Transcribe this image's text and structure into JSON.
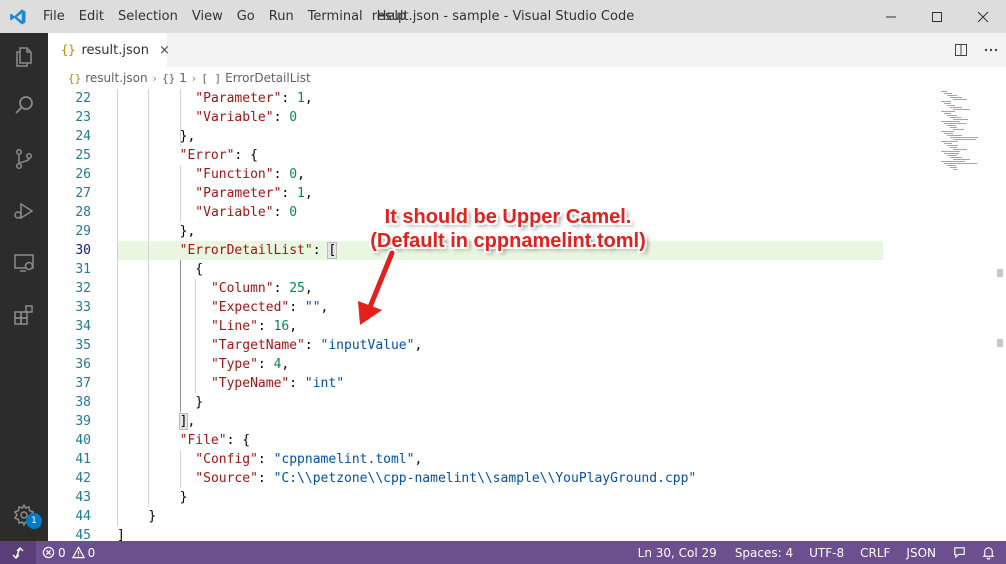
{
  "window": {
    "title": "result.json - sample - Visual Studio Code",
    "menu": [
      "File",
      "Edit",
      "Selection",
      "View",
      "Go",
      "Run",
      "Terminal",
      "Help"
    ]
  },
  "activity": {
    "icons": [
      "files-icon",
      "search-icon",
      "source-control-icon",
      "run-debug-icon",
      "remote-explorer-icon",
      "extensions-icon"
    ],
    "settings_badge": "1"
  },
  "tab": {
    "icon": "{}",
    "label": "result.json",
    "close": "×"
  },
  "breadcrumb": {
    "file": "result.json",
    "obj_icon": "{}",
    "obj": "1",
    "arr_icon": "[ ]",
    "arr": "ErrorDetailList"
  },
  "editor": {
    "current_line": 30,
    "lines": [
      {
        "n": "22",
        "indent": 5,
        "tokens": [
          [
            "k",
            "\"Parameter\""
          ],
          [
            "p",
            ": "
          ],
          [
            "n",
            "1"
          ],
          [
            "p",
            ","
          ]
        ]
      },
      {
        "n": "23",
        "indent": 5,
        "tokens": [
          [
            "k",
            "\"Variable\""
          ],
          [
            "p",
            ": "
          ],
          [
            "n",
            "0"
          ]
        ]
      },
      {
        "n": "24",
        "indent": 4,
        "tokens": [
          [
            "p",
            "},"
          ]
        ]
      },
      {
        "n": "25",
        "indent": 4,
        "tokens": [
          [
            "k",
            "\"Error\""
          ],
          [
            "p",
            ": {"
          ]
        ]
      },
      {
        "n": "26",
        "indent": 5,
        "tokens": [
          [
            "k",
            "\"Function\""
          ],
          [
            "p",
            ": "
          ],
          [
            "n",
            "0"
          ],
          [
            "p",
            ","
          ]
        ]
      },
      {
        "n": "27",
        "indent": 5,
        "tokens": [
          [
            "k",
            "\"Parameter\""
          ],
          [
            "p",
            ": "
          ],
          [
            "n",
            "1"
          ],
          [
            "p",
            ","
          ]
        ]
      },
      {
        "n": "28",
        "indent": 5,
        "tokens": [
          [
            "k",
            "\"Variable\""
          ],
          [
            "p",
            ": "
          ],
          [
            "n",
            "0"
          ]
        ]
      },
      {
        "n": "29",
        "indent": 4,
        "tokens": [
          [
            "p",
            "},"
          ]
        ]
      },
      {
        "n": "30",
        "indent": 4,
        "tokens": [
          [
            "k",
            "\"ErrorDetailList\""
          ],
          [
            "p",
            ": "
          ],
          [
            "b",
            "["
          ]
        ]
      },
      {
        "n": "31",
        "indent": 5,
        "tokens": [
          [
            "p",
            "{"
          ]
        ]
      },
      {
        "n": "32",
        "indent": 6,
        "tokens": [
          [
            "k",
            "\"Column\""
          ],
          [
            "p",
            ": "
          ],
          [
            "n",
            "25"
          ],
          [
            "p",
            ","
          ]
        ]
      },
      {
        "n": "33",
        "indent": 6,
        "tokens": [
          [
            "k",
            "\"Expected\""
          ],
          [
            "p",
            ": "
          ],
          [
            "s",
            "\"\""
          ],
          [
            "p",
            ","
          ]
        ]
      },
      {
        "n": "34",
        "indent": 6,
        "tokens": [
          [
            "k",
            "\"Line\""
          ],
          [
            "p",
            ": "
          ],
          [
            "n",
            "16"
          ],
          [
            "p",
            ","
          ]
        ]
      },
      {
        "n": "35",
        "indent": 6,
        "tokens": [
          [
            "k",
            "\"TargetName\""
          ],
          [
            "p",
            ": "
          ],
          [
            "s",
            "\"inputValue\""
          ],
          [
            "p",
            ","
          ]
        ]
      },
      {
        "n": "36",
        "indent": 6,
        "tokens": [
          [
            "k",
            "\"Type\""
          ],
          [
            "p",
            ": "
          ],
          [
            "n",
            "4"
          ],
          [
            "p",
            ","
          ]
        ]
      },
      {
        "n": "37",
        "indent": 6,
        "tokens": [
          [
            "k",
            "\"TypeName\""
          ],
          [
            "p",
            ": "
          ],
          [
            "s",
            "\"int\""
          ]
        ]
      },
      {
        "n": "38",
        "indent": 5,
        "tokens": [
          [
            "p",
            "}"
          ]
        ]
      },
      {
        "n": "39",
        "indent": 4,
        "tokens": [
          [
            "b",
            "]"
          ],
          [
            "p",
            ","
          ]
        ]
      },
      {
        "n": "40",
        "indent": 4,
        "tokens": [
          [
            "k",
            "\"File\""
          ],
          [
            "p",
            ": {"
          ]
        ]
      },
      {
        "n": "41",
        "indent": 5,
        "tokens": [
          [
            "k",
            "\"Config\""
          ],
          [
            "p",
            ": "
          ],
          [
            "s",
            "\"cppnamelint.toml\""
          ],
          [
            "p",
            ","
          ]
        ]
      },
      {
        "n": "42",
        "indent": 5,
        "tokens": [
          [
            "k",
            "\"Source\""
          ],
          [
            "p",
            ": "
          ],
          [
            "s",
            "\"C:\\\\petzone\\\\cpp-namelint\\\\sample\\\\YouPlayGround.cpp\""
          ]
        ]
      },
      {
        "n": "43",
        "indent": 4,
        "tokens": [
          [
            "p",
            "}"
          ]
        ]
      },
      {
        "n": "44",
        "indent": 2,
        "tokens": [
          [
            "p",
            "}"
          ]
        ]
      },
      {
        "n": "45",
        "indent": 0,
        "tokens": [
          [
            "p",
            "]"
          ]
        ]
      }
    ]
  },
  "callout": {
    "line1": "It should be Upper Camel.",
    "line2": "(Default in cppnamelint.toml)",
    "color": "#e3201b"
  },
  "status": {
    "errors": "0",
    "warnings": "0",
    "position": "Ln 30, Col 29",
    "spaces": "Spaces: 4",
    "encoding": "UTF-8",
    "eol": "CRLF",
    "language": "JSON",
    "bg_color": "#6c4f8e"
  }
}
